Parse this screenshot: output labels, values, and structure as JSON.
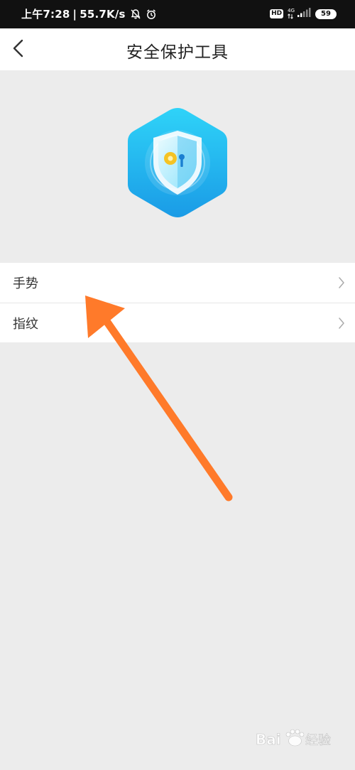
{
  "status_bar": {
    "time": "上午7:28",
    "separator": "|",
    "speed": "55.7K/s",
    "hd": "HD",
    "network": "4G",
    "battery": "59"
  },
  "nav": {
    "title": "安全保护工具",
    "back_icon": "chevron-left-icon"
  },
  "hero": {
    "icon": "shield-key-icon",
    "colors": {
      "hex_light": "#2fd3f8",
      "hex_dark": "#1a9be6",
      "key": "#f5c324"
    }
  },
  "list": {
    "items": [
      {
        "label": "手势",
        "icon": "chevron-right-icon"
      },
      {
        "label": "指纹",
        "icon": "chevron-right-icon"
      }
    ]
  },
  "annotation": {
    "arrow_color": "#ff7a2a"
  },
  "watermark": {
    "text": "Bai度经验"
  }
}
